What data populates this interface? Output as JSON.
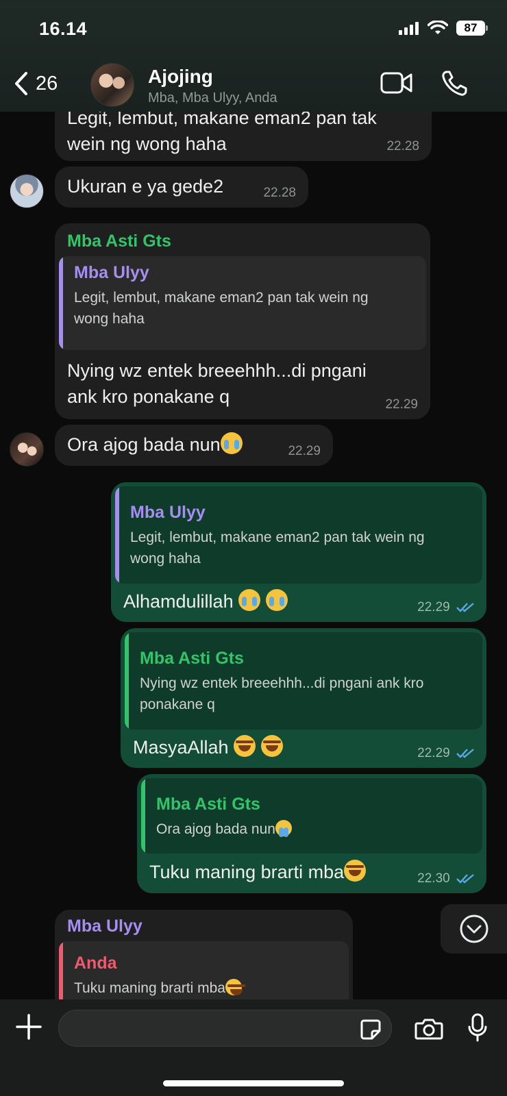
{
  "status_bar": {
    "time": "16.14",
    "battery": "87"
  },
  "header": {
    "back_count": "26",
    "title": "Ajojing",
    "subtitle": "Mba, Mba Ulyy, Anda"
  },
  "messages": [
    {
      "type": "in",
      "text_line1": "Legit, lembut, makane eman2 pan tak",
      "text_line2": "wein ng wong haha",
      "time": "22.28"
    },
    {
      "type": "in",
      "text": "Ukuran e ya gede2",
      "time": "22.28"
    },
    {
      "type": "in",
      "sender": "Mba Asti Gts",
      "quote": {
        "author": "Mba Ulyy",
        "text_line1": "Legit, lembut, makane eman2 pan tak wein ng",
        "text_line2": "wong haha"
      },
      "text_line1": "Nying wz entek breeehhh...di pngani",
      "text_line2": "ank kro ponakane q",
      "time": "22.29"
    },
    {
      "type": "in",
      "text": "Ora ajog bada nun",
      "time": "22.29"
    },
    {
      "type": "out",
      "quote": {
        "author": "Mba Ulyy",
        "text_line1": "Legit, lembut, makane eman2 pan tak wein ng",
        "text_line2": "wong haha"
      },
      "text": "Alhamdulillah",
      "time": "22.29"
    },
    {
      "type": "out",
      "quote": {
        "author": "Mba Asti Gts",
        "text_line1": "Nying wz entek breeehhh...di pngani ank kro",
        "text_line2": "ponakane q"
      },
      "text": "MasyaAllah",
      "time": "22.29"
    },
    {
      "type": "out",
      "quote": {
        "author": "Mba Asti Gts",
        "text": "Ora ajog bada nun"
      },
      "text": "Tuku maning brarti mba",
      "time": "22.30"
    },
    {
      "type": "in",
      "sender": "Mba Ulyy",
      "quote": {
        "author": "Anda",
        "text": "Tuku maning brarti mba"
      }
    }
  ],
  "colors": {
    "incoming": "#1f1f1f",
    "outgoing": "#134d37",
    "green_name": "#33c36a",
    "purple_name": "#a58df2",
    "red_name": "#f05a6e"
  },
  "icons": [
    "back-chevron-icon",
    "video-call-icon",
    "phone-icon",
    "scroll-down-icon",
    "plus-icon",
    "sticker-icon",
    "camera-icon",
    "microphone-icon",
    "double-check-icon",
    "crying-emoji",
    "laughing-emoji"
  ]
}
